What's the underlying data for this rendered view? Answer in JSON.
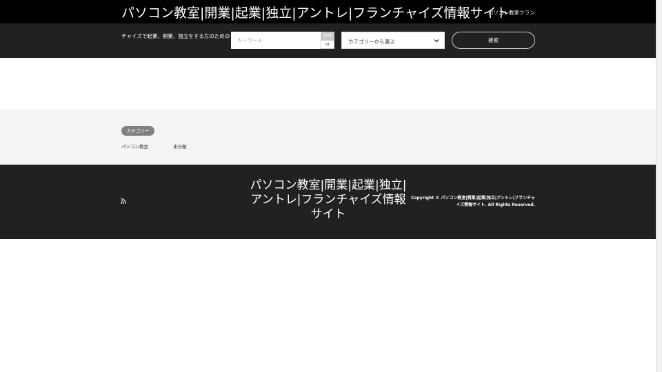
{
  "header": {
    "site_title": "パソコン教室|開業|起業|独立|アントレ|フランチャイズ情報サイト",
    "description": "パソコン教室フランチャイズで起業、開業、独立をする方のための情報サイト"
  },
  "search": {
    "description": "チャイズで起業、開業、独立をする方のための情報",
    "keyword_placeholder": "キーワード",
    "keyword_value": "",
    "operator_and": "and",
    "operator_or": "or",
    "category_select_label": "カテゴリーから選ぶ",
    "submit_label": "検索"
  },
  "categories": {
    "badge": "カテゴリー",
    "links": [
      "パソコン教室",
      "未分類"
    ]
  },
  "footer": {
    "title": "パソコン教室|開業|起業|独立|アントレ|フランチャイズ情報サイト",
    "copyright": "Copyright © パソコン教室|開業|起業|独立|アントレ|フランチャイズ情報サイト. All Rights Reserved."
  },
  "icons": {
    "select_arrow": "chevron-down-icon",
    "feed": "rss-icon"
  },
  "colors": {
    "top_bar": "#000000",
    "search_bar": "#212121",
    "category_area": "#f4f4f4",
    "footer": "#212121",
    "badge": "#808080"
  }
}
